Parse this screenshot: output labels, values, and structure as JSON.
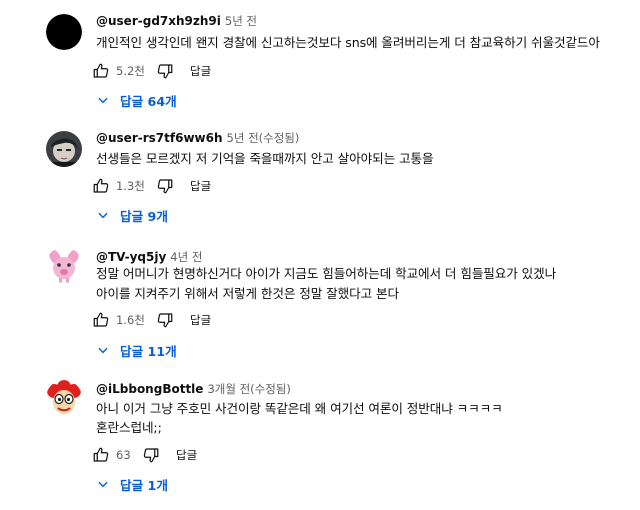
{
  "comments": [
    {
      "author": "@user-gd7xh9zh9i",
      "time": "5년 전",
      "lines": [
        "개인적인 생각인데 왠지 경찰에 신고하는것보다 sns에 올려버리는게 더 참교육하기 쉬울것같드아"
      ],
      "likes": "5.2천",
      "reply_label": "답글",
      "replies_label": "답글 64개",
      "avatar": "black-circle"
    },
    {
      "author": "@user-rs7tf6ww6h",
      "time": "5년 전(수정됨)",
      "lines": [
        "선생들은 모르겠지 저 기억을 죽을때까지 안고 살아야되는 고통을"
      ],
      "likes": "1.3천",
      "reply_label": "답글",
      "replies_label": "답글 9개",
      "avatar": "face-photo"
    },
    {
      "author": "@TV-yq5jy",
      "time": "4년 전",
      "lines": [
        "정말 어머니가 현명하신거다 아이가 지금도 힘들어하는데 학교에서 더 힘들필요가 있겠나",
        "아이를 지켜주기 위해서 저렇게 한것은 정말 잘했다고 본다"
      ],
      "likes": "1.6천",
      "reply_label": "답글",
      "replies_label": "답글 11개",
      "avatar": "pink-cartoon"
    },
    {
      "author": "@iLbbongBottle",
      "time": "3개월 전(수정됨)",
      "lines": [
        "아니 이거 그냥 주호민 사건이랑 똑같은데 왜 여기선 여론이 정반대냐 ㅋㅋㅋㅋ",
        "혼란스럽네;;"
      ],
      "likes": "63",
      "reply_label": "답글",
      "replies_label": "답글 1개",
      "avatar": "clown-cartoon"
    }
  ],
  "colors": {
    "link": "#065fd4",
    "muted": "#606060",
    "text": "#0f0f0f"
  },
  "icons": [
    "thumb-up-icon",
    "thumb-down-icon",
    "chevron-down-icon"
  ]
}
